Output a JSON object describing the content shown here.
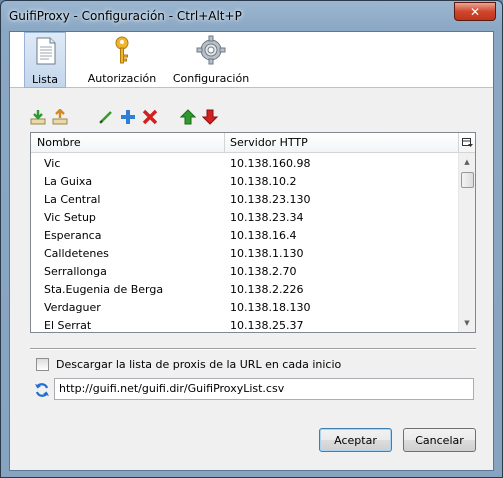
{
  "window": {
    "title": "GuifiProxy - Configuración - Ctrl+Alt+P",
    "close_symbol": "✕"
  },
  "tabs": [
    {
      "label": "Lista",
      "icon": "document-icon",
      "active": true
    },
    {
      "label": "Autorización",
      "icon": "key-icon",
      "active": false
    },
    {
      "label": "Configuración",
      "icon": "gear-icon",
      "active": false
    }
  ],
  "toolbar": {
    "buttons": [
      "import-icon",
      "export-icon",
      "edit-icon",
      "add-icon",
      "delete-icon",
      "move-up-icon",
      "move-down-icon"
    ],
    "colors": {
      "green": "#2e9a2e",
      "blue": "#2f7fd8",
      "red": "#d22020"
    }
  },
  "list": {
    "columns": [
      "Nombre",
      "Servidor HTTP"
    ],
    "rows": [
      {
        "name": "Vic",
        "server": "10.138.160.98"
      },
      {
        "name": "La Guixa",
        "server": "10.138.10.2"
      },
      {
        "name": "La Central",
        "server": "10.138.23.130"
      },
      {
        "name": "Vic Setup",
        "server": "10.138.23.34"
      },
      {
        "name": "Esperanca",
        "server": "10.138.16.4"
      },
      {
        "name": "Calldetenes",
        "server": "10.138.1.130"
      },
      {
        "name": "Serrallonga",
        "server": "10.138.2.70"
      },
      {
        "name": "Sta.Eugenia de Berga",
        "server": "10.138.2.226"
      },
      {
        "name": "Verdaguer",
        "server": "10.138.18.130"
      },
      {
        "name": "El Serrat",
        "server": "10.138.25.37"
      }
    ]
  },
  "download": {
    "checkbox_label": "Descargar la lista de proxis de la URL en cada inicio",
    "checked": false,
    "url": "http://guifi.net/guifi.dir/GuifiProxyList.csv"
  },
  "buttons": {
    "accept": "Aceptar",
    "cancel": "Cancelar"
  }
}
